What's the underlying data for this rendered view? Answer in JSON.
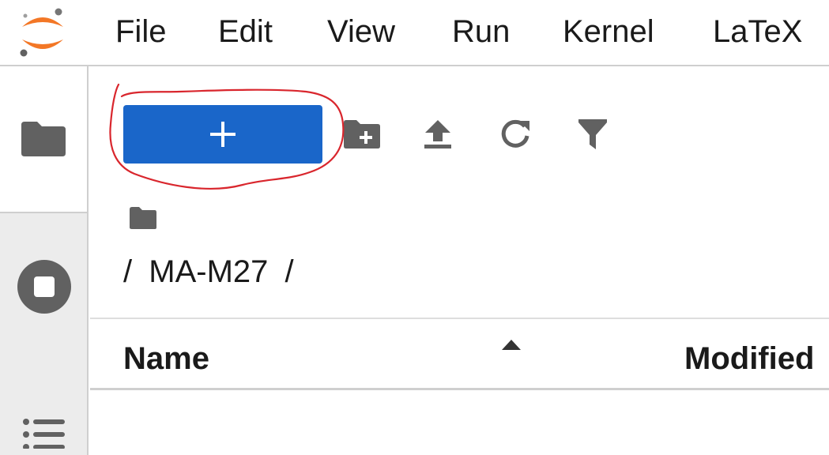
{
  "menubar": {
    "logo_icon": "jupyter-logo-icon",
    "items": [
      {
        "label": "File"
      },
      {
        "label": "Edit"
      },
      {
        "label": "View"
      },
      {
        "label": "Run"
      },
      {
        "label": "Kernel"
      },
      {
        "label": "LaTeX"
      }
    ]
  },
  "sidebar": {
    "tabs": [
      {
        "icon": "folder-icon",
        "active": true
      },
      {
        "icon": "stop-circle-icon",
        "active": false
      },
      {
        "icon": "list-icon",
        "active": false
      }
    ]
  },
  "file_browser": {
    "toolbar": {
      "new_launcher_icon": "plus-icon",
      "new_folder_icon": "new-folder-icon",
      "upload_icon": "upload-icon",
      "refresh_icon": "refresh-icon",
      "filter_icon": "filter-icon"
    },
    "breadcrumb": {
      "home_icon": "folder-icon",
      "separator": "/",
      "current": "MA-M27"
    },
    "listing": {
      "columns": [
        {
          "label": "Name",
          "sorted": "ascending"
        },
        {
          "label": "Modified"
        }
      ],
      "rows": []
    }
  },
  "colors": {
    "accent": "#1a66c9",
    "annotation": "#d9262d",
    "logo_orange": "#f37726",
    "icon_gray": "#616161",
    "sidebar_bg": "#ececec"
  }
}
